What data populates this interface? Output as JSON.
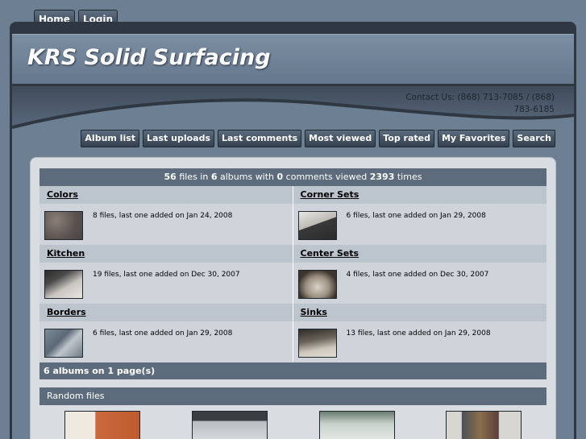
{
  "topnav": {
    "home": "Home",
    "login": "Login"
  },
  "site": {
    "title": "KRS Solid Surfacing",
    "contact": "Contact Us: (868) 713-7085 / (868) 783-6185"
  },
  "subnav": [
    "Album list",
    "Last uploads",
    "Last comments",
    "Most viewed",
    "Top rated",
    "My Favorites",
    "Search"
  ],
  "stats": {
    "files": "56",
    "files_label": " files in ",
    "albums": "6",
    "albums_label": " albums with ",
    "comments": "0",
    "comments_label": " comments viewed ",
    "views": "2393",
    "views_label": " times"
  },
  "albums": [
    {
      "name": "Colors",
      "info": "8 files, last one added on Jan 24, 2008"
    },
    {
      "name": "Corner Sets",
      "info": "6 files, last one added on Jan 29, 2008"
    },
    {
      "name": "Kitchen",
      "info": "19 files, last one added on Dec 30, 2007"
    },
    {
      "name": "Center Sets",
      "info": "4 files, last one added on Dec 30, 2007"
    },
    {
      "name": "Borders",
      "info": "6 files, last one added on Jan 29, 2008"
    },
    {
      "name": "Sinks",
      "info": "13 files, last one added on Jan 29, 2008"
    }
  ],
  "pagination": "6 albums on 1 page(s)",
  "random": {
    "title": "Random files"
  },
  "colors": {
    "dark": "#2f3742",
    "bar": "#5d6c7d",
    "page": "#6d7f93"
  }
}
